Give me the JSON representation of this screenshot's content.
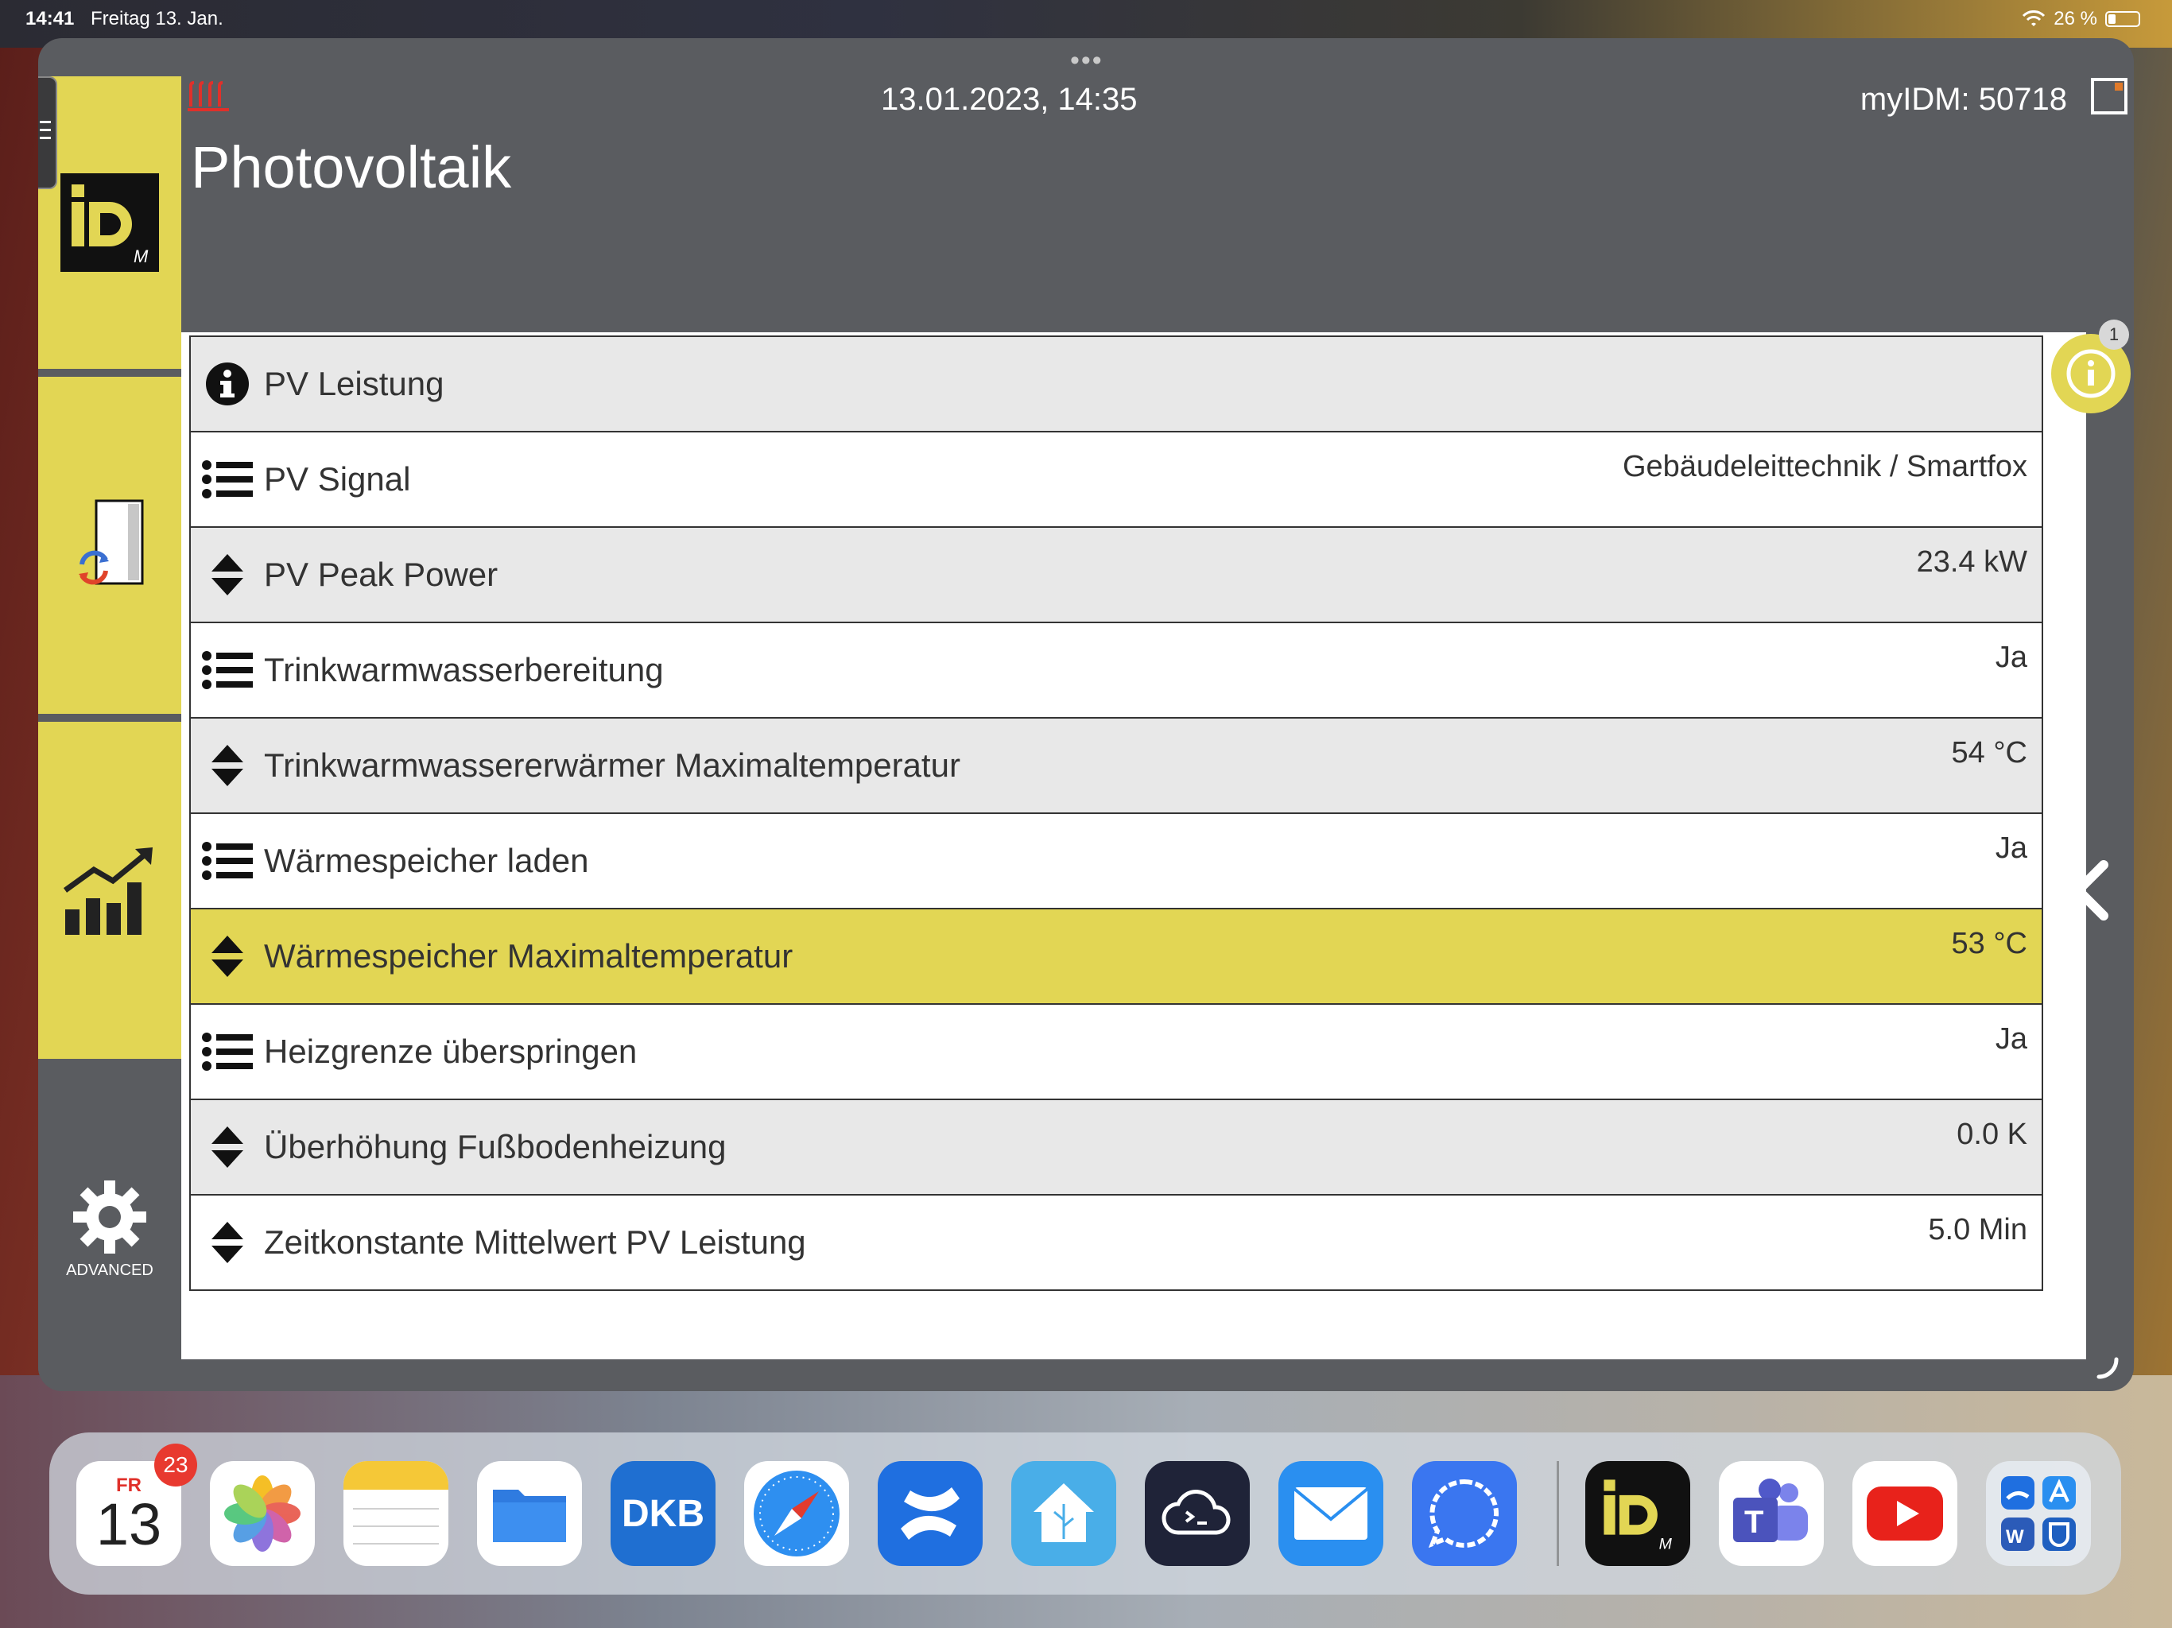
{
  "status_bar": {
    "time": "14:41",
    "date": "Freitag 13. Jan.",
    "battery": "26 %",
    "battery_fraction": 0.26
  },
  "window": {
    "dots": "•••"
  },
  "header": {
    "datetime": "13.01.2023, 14:35",
    "myidm": "myIDM: 50718",
    "title": "Photovoltaik"
  },
  "sidebar": {
    "advanced_label": "ADVANCED"
  },
  "rows": [
    {
      "icon": "info-icon",
      "label": "PV Leistung",
      "value": ""
    },
    {
      "icon": "list-icon",
      "label": "PV Signal",
      "value": "Gebäudeleittechnik / Smartfox"
    },
    {
      "icon": "updown-icon",
      "label": "PV Peak Power",
      "value": "23.4 kW"
    },
    {
      "icon": "list-icon",
      "label": "Trinkwarmwasserbereitung",
      "value": "Ja"
    },
    {
      "icon": "updown-icon",
      "label": "Trinkwarmwassererwärmer Maximaltemperatur",
      "value": "54 °C"
    },
    {
      "icon": "list-icon",
      "label": "Wärmespeicher laden",
      "value": "Ja"
    },
    {
      "icon": "updown-icon",
      "label": "Wärmespeicher Maximaltemperatur",
      "value": "53 °C"
    },
    {
      "icon": "list-icon",
      "label": "Heizgrenze überspringen",
      "value": "Ja"
    },
    {
      "icon": "updown-icon",
      "label": "Überhöhung Fußbodenheizung",
      "value": "0.0 K"
    },
    {
      "icon": "updown-icon",
      "label": "Zeitkonstante Mittelwert PV Leistung",
      "value": "5.0 Min"
    }
  ],
  "info_badge": "1",
  "dock": {
    "calendar_day": "FR",
    "calendar_date": "13",
    "calendar_badge": "23",
    "dkb_label": "DKB",
    "apps": [
      "Calendar",
      "Photos",
      "Notes",
      "Files",
      "DKB",
      "Safari",
      "Confluence",
      "Home Assistant",
      "Prompt",
      "Mail",
      "Signal",
      "myIDM",
      "Teams",
      "YouTube",
      "App Library"
    ]
  }
}
